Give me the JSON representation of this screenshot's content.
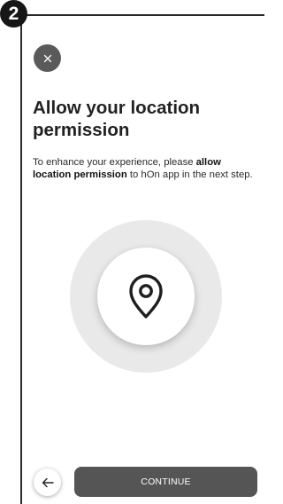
{
  "step": {
    "number": "2"
  },
  "header": {
    "close_icon": "close-icon"
  },
  "content": {
    "title": "Allow your location permission",
    "body_before": "To enhance your experience, please ",
    "body_bold": "allow location permission",
    "body_after": " to hOn app in the next step."
  },
  "illustration": {
    "icon": "location-pin-icon"
  },
  "footer": {
    "back_icon": "arrow-left-icon",
    "continue_label": "CONTINUE"
  },
  "colors": {
    "badge": "#161616",
    "close_button": "#5a5a5a",
    "continue_button": "#555555",
    "halo": "#e9e9e9"
  }
}
